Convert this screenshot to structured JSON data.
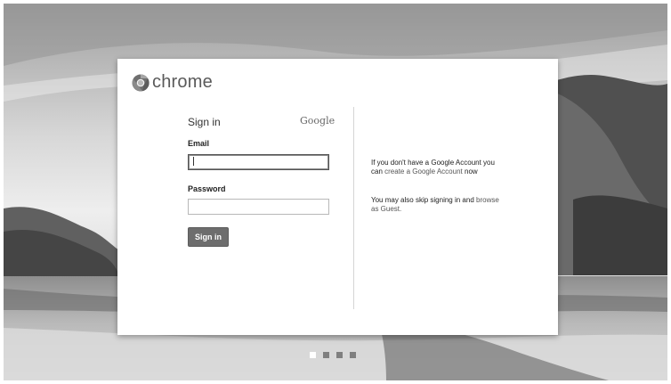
{
  "brand": {
    "name": "chrome",
    "icon": "chrome-logo-icon"
  },
  "signin": {
    "title": "Sign in",
    "provider_logo": "Google",
    "email_label": "Email",
    "email_value": "",
    "password_label": "Password",
    "password_value": "",
    "button_label": "Sign in"
  },
  "side": {
    "account_text_1": "If you don't have a Google Account you can",
    "create_link": "create a Google Account",
    "account_text_2": "now",
    "guest_text": "You may also skip signing in and",
    "guest_link": "browse as Guest."
  },
  "pager": {
    "total": 4,
    "active_index": 0
  },
  "colors": {
    "card_bg": "#ffffff",
    "button_bg": "#6d6d6d",
    "text": "#222222"
  }
}
